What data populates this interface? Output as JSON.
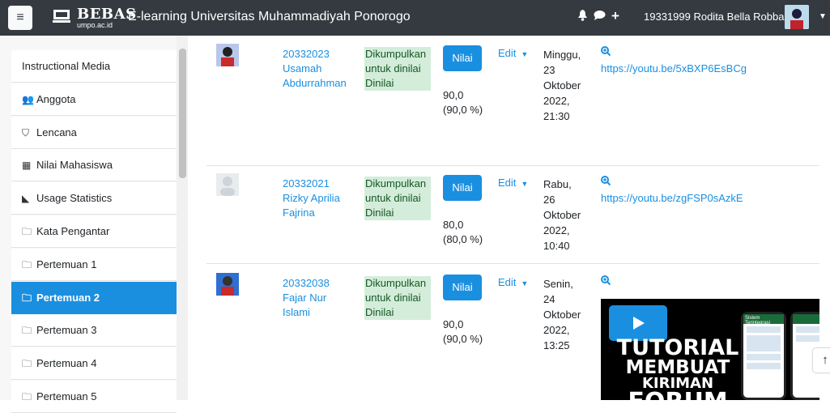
{
  "header": {
    "brand_main": "BEBAS",
    "brand_sub": "umpo.ac.id",
    "site_title": "E-learning Universitas Muhammadiyah Ponorogo",
    "user_name": "19331999 Rodita Bella Robba"
  },
  "sidebar": {
    "items": [
      {
        "label": "Instructional Media",
        "icon": ""
      },
      {
        "label": "Anggota",
        "icon": "users-icon"
      },
      {
        "label": "Lencana",
        "icon": "shield-icon"
      },
      {
        "label": "Nilai Mahasiswa",
        "icon": "table-icon"
      },
      {
        "label": "Usage Statistics",
        "icon": "area-chart-icon"
      },
      {
        "label": "Kata Pengantar",
        "icon": "folder-icon"
      },
      {
        "label": "Pertemuan 1",
        "icon": "folder-icon"
      },
      {
        "label": "Pertemuan 2",
        "icon": "folder-icon"
      },
      {
        "label": "Pertemuan 3",
        "icon": "folder-icon"
      },
      {
        "label": "Pertemuan 4",
        "icon": "folder-icon"
      },
      {
        "label": "Pertemuan 5",
        "icon": "folder-icon"
      }
    ],
    "active_index": 7
  },
  "submissions": [
    {
      "student_lines": [
        "20332023",
        "Usamah",
        "Abdurrahman"
      ],
      "status_lines": [
        "Dikumpulkan",
        "untuk dinilai",
        "Dinilai"
      ],
      "grade_button": "Nilai",
      "grade_lines": [
        "90,0",
        "(90,0 %)"
      ],
      "edit_label": "Edit",
      "date_lines": [
        "Minggu,",
        "23",
        "Oktober",
        "2022,",
        "21:30"
      ],
      "link": "https://youtu.be/5xBXP6EsBCg"
    },
    {
      "student_lines": [
        "20332021",
        "Rizky Aprilia",
        "Fajrina"
      ],
      "status_lines": [
        "Dikumpulkan",
        "untuk dinilai",
        "Dinilai"
      ],
      "grade_button": "Nilai",
      "grade_lines": [
        "80,0",
        "(80,0 %)"
      ],
      "edit_label": "Edit",
      "date_lines": [
        "Rabu,",
        "26",
        "Oktober",
        "2022,",
        "10:40"
      ],
      "link": "https://youtu.be/zgFSP0sAzkE"
    },
    {
      "student_lines": [
        "20332038",
        "Fajar Nur",
        "Islami"
      ],
      "status_lines": [
        "Dikumpulkan",
        "untuk dinilai",
        "Dinilai"
      ],
      "grade_button": "Nilai",
      "grade_lines": [
        "90,0",
        "(90,0 %)"
      ],
      "edit_label": "Edit",
      "date_lines": [
        "Senin,",
        "24",
        "Oktober",
        "2022,",
        "13:25"
      ],
      "link": ""
    }
  ],
  "video": {
    "title_lines": [
      "TUTORIAL",
      "MEMBUAT",
      "KIRIMAN",
      "FORUM"
    ],
    "phone_text": "Sistem Terintegrasi"
  },
  "colors": {
    "accent": "#1a8fe0",
    "topbar": "#343a40",
    "status_bg": "#d4edda"
  }
}
